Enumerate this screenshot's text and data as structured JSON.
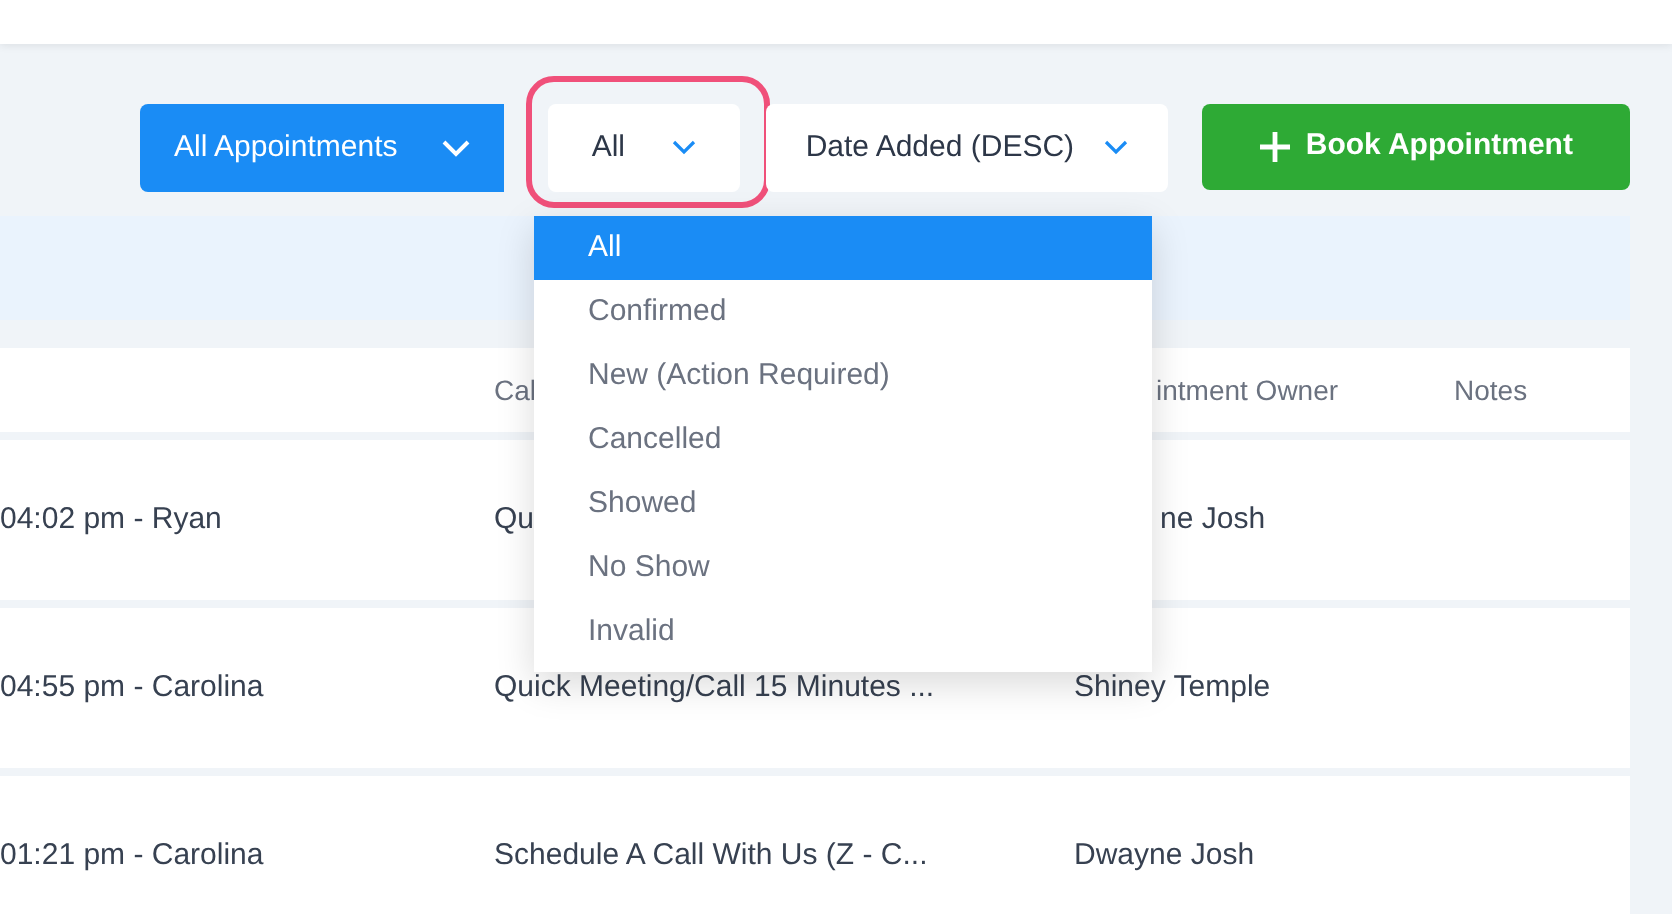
{
  "toolbar": {
    "calendar_filter": "All Appointments",
    "status_filter": "All",
    "sort_filter": "Date Added (DESC)",
    "book_button": "Book Appointment"
  },
  "status_menu": {
    "items": [
      {
        "label": "All",
        "selected": true
      },
      {
        "label": "Confirmed",
        "selected": false
      },
      {
        "label": "New (Action Required)",
        "selected": false
      },
      {
        "label": "Cancelled",
        "selected": false
      },
      {
        "label": "Showed",
        "selected": false
      },
      {
        "label": "No Show",
        "selected": false
      },
      {
        "label": "Invalid",
        "selected": false
      }
    ]
  },
  "table": {
    "columns": [
      "",
      "Cal",
      "intment Owner",
      "Notes"
    ],
    "rows": [
      {
        "cells": [
          "04:02 pm - Ryan",
          "Qu",
          "ne Josh",
          ""
        ]
      },
      {
        "cells": [
          "04:55 pm - Carolina",
          "Quick Meeting/Call 15 Minutes ...",
          "Shiney Temple",
          ""
        ]
      },
      {
        "cells": [
          "01:21 pm - Carolina",
          "Schedule A Call With Us (Z - C...",
          "Dwayne Josh",
          ""
        ]
      }
    ]
  }
}
